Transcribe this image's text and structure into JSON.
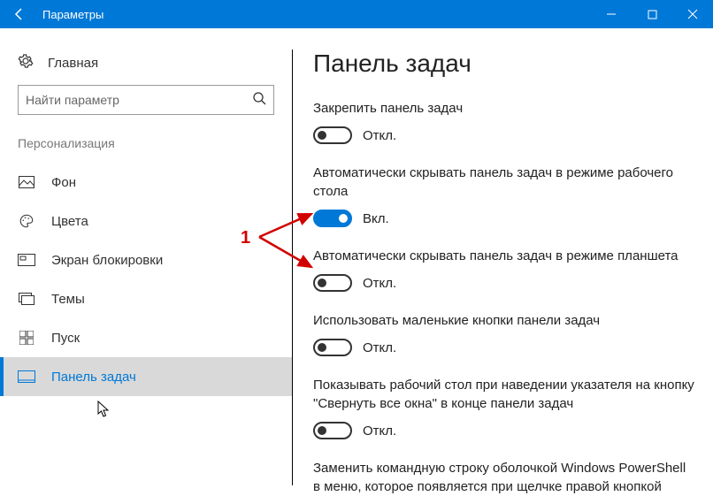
{
  "window": {
    "title": "Параметры"
  },
  "sidebar": {
    "home": "Главная",
    "searchPlaceholder": "Найти параметр",
    "section": "Персонализация",
    "items": [
      {
        "label": "Фон"
      },
      {
        "label": "Цвета"
      },
      {
        "label": "Экран блокировки"
      },
      {
        "label": "Темы"
      },
      {
        "label": "Пуск"
      },
      {
        "label": "Панель задач"
      }
    ]
  },
  "page": {
    "title": "Панель задач",
    "settings": [
      {
        "label": "Закрепить панель задач",
        "state": "Откл.",
        "on": false
      },
      {
        "label": "Автоматически скрывать панель задач в режиме рабочего стола",
        "state": "Вкл.",
        "on": true
      },
      {
        "label": "Автоматически скрывать панель задач в режиме планшета",
        "state": "Откл.",
        "on": false
      },
      {
        "label": "Использовать маленькие кнопки панели задач",
        "state": "Откл.",
        "on": false
      },
      {
        "label": "Показывать рабочий стол при наведении указателя на кнопку \"Свернуть все окна\" в конце панели задач",
        "state": "Откл.",
        "on": false
      },
      {
        "label": "Заменить командную строку оболочкой Windows PowerShell в меню, которое появляется при щелчке правой кнопкой",
        "state": "",
        "on": false
      }
    ]
  },
  "annotation": {
    "label": "1"
  }
}
